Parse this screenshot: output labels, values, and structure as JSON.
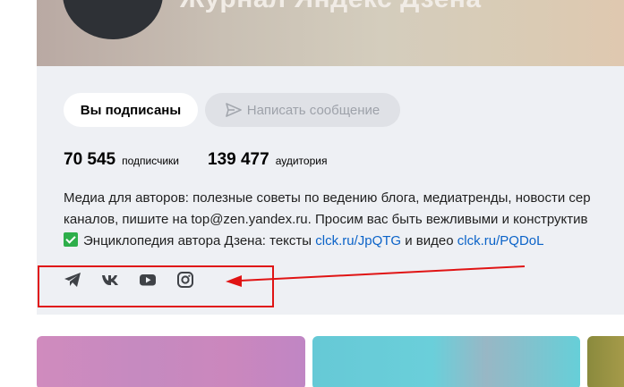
{
  "channel": {
    "title": "Журнал Яндекс Дзена"
  },
  "buttons": {
    "subscribed_label": "Вы подписаны",
    "message_label": "Написать сообщение"
  },
  "stats": {
    "subscribers_value": "70 545",
    "subscribers_label": "подписчики",
    "audience_value": "139 477",
    "audience_label": "аудитория"
  },
  "description": {
    "line1": "Медиа для авторов: полезные советы по ведению блога, медиатренды, новости сер",
    "line2": "каналов, пишите на top@zen.yandex.ru. Просим вас быть вежливыми и конструктив",
    "line3_prefix": "Энциклопедия автора Дзена: тексты ",
    "line3_link1": "clck.ru/JpQTG",
    "line3_middle": " и видео ",
    "line3_link2": "clck.ru/PQDoL"
  },
  "socials": [
    {
      "icon": "telegram-icon"
    },
    {
      "icon": "vk-icon"
    },
    {
      "icon": "youtube-icon"
    },
    {
      "icon": "instagram-icon"
    }
  ],
  "colors": {
    "card_bg": "#eef0f4",
    "link": "#0b63c8",
    "annotation": "#e01414",
    "check": "#2dae4a"
  }
}
